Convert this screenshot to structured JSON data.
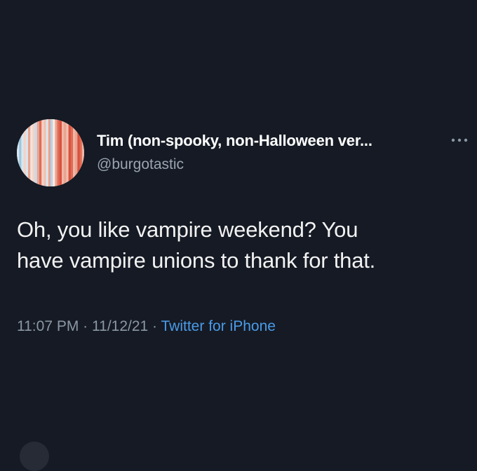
{
  "tweet": {
    "display_name": "Tim (non-spooky, non-Halloween ver...",
    "handle": "@burgotastic",
    "text_line1": "Oh, you like vampire weekend? You",
    "text_line2": "have vampire unions to thank for that.",
    "time": "11:07 PM",
    "separator": "·",
    "date": "11/12/21",
    "source": "Twitter for iPhone"
  },
  "icons": {
    "avatar": "avatar-stripes-image",
    "more": "more-options-icon"
  },
  "colors": {
    "background": "#151a24",
    "text": "#f2f2f2",
    "secondary": "#8b98a5",
    "link": "#4a9be8"
  }
}
